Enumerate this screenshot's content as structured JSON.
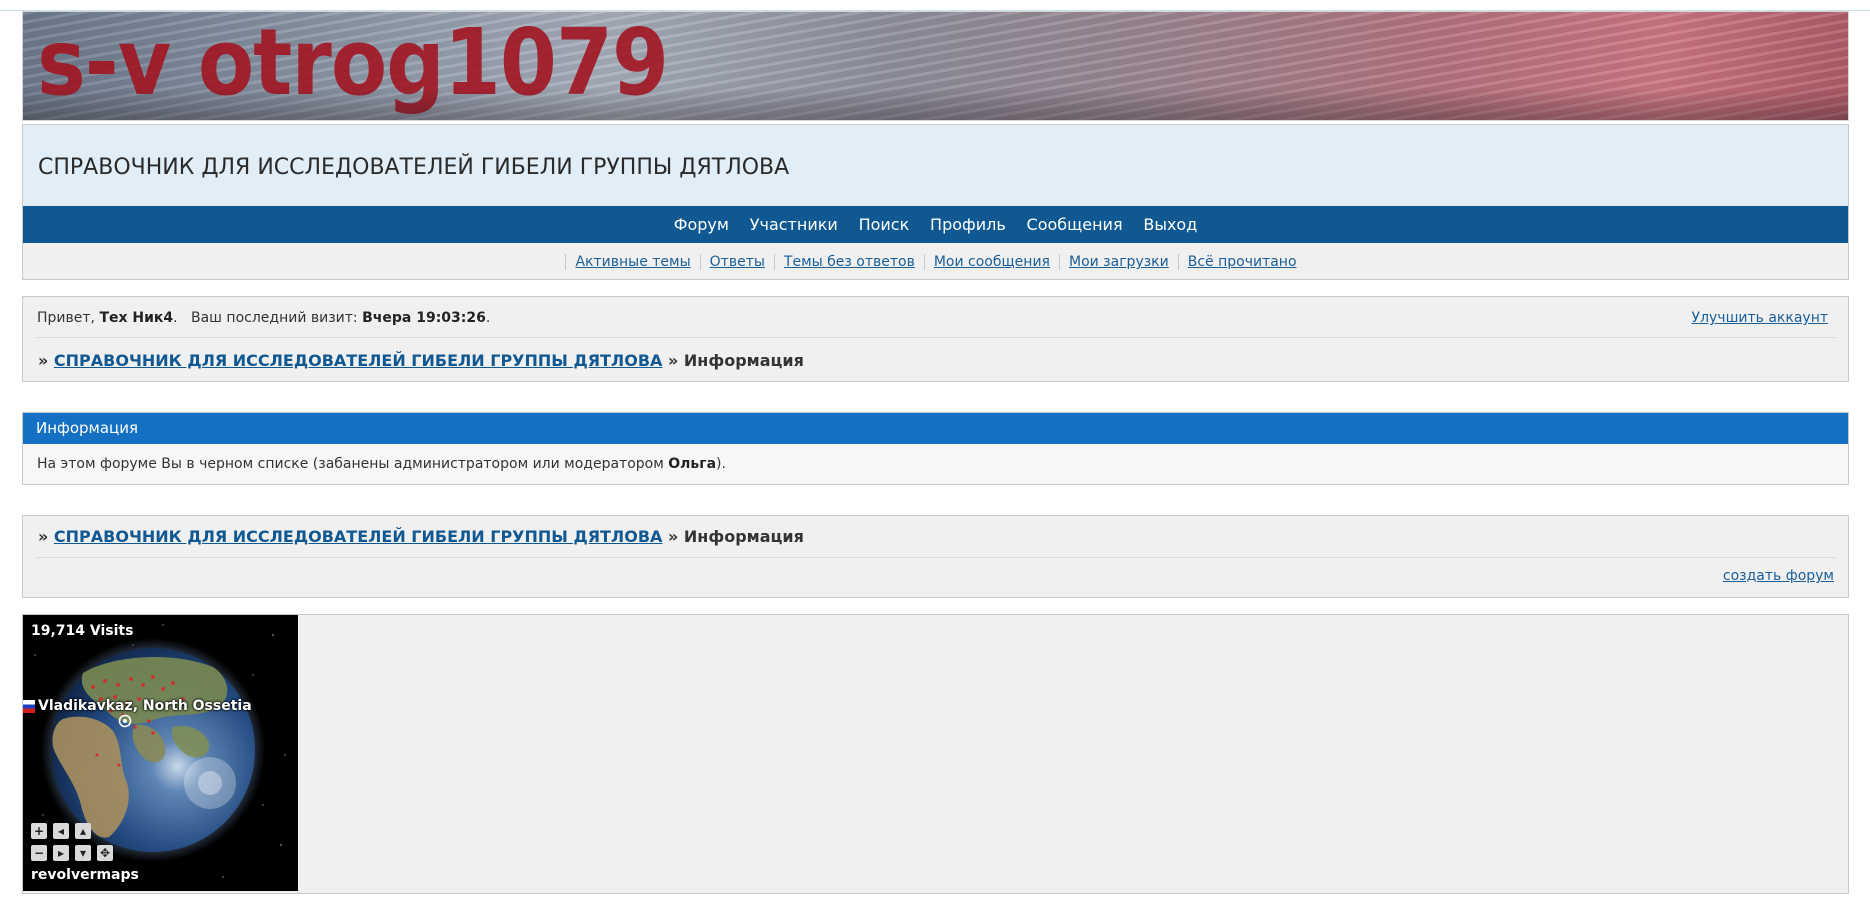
{
  "banner": {
    "title": "s-v otrog1079"
  },
  "site": {
    "title": "СПРАВОЧНИК ДЛЯ ИССЛЕДОВАТЕЛЕЙ ГИБЕЛИ ГРУППЫ ДЯТЛОВА"
  },
  "nav": {
    "main": [
      "Форум",
      "Участники",
      "Поиск",
      "Профиль",
      "Сообщения",
      "Выход"
    ],
    "sub": [
      "Активные темы",
      "Ответы",
      "Темы без ответов",
      "Мои сообщения",
      "Мои загрузки",
      "Всё прочитано"
    ]
  },
  "welcome": {
    "greeting": "Привет,",
    "username": "Тех Ник4",
    "last_visit_label": "Ваш последний визит:",
    "last_visit_value": "Вчера 19:03:26",
    "upgrade": "Улучшить аккаунт"
  },
  "breadcrumb": {
    "sep": "»",
    "forum": "СПРАВОЧНИК ДЛЯ ИССЛЕДОВАТЕЛЕЙ ГИБЕЛИ ГРУППЫ ДЯТЛОВА",
    "current": "Информация"
  },
  "info": {
    "header": "Информация",
    "message_before": "На этом форуме Вы в черном списке (забанены администратором или модератором",
    "moderator": "Ольга",
    "message_after": ")."
  },
  "footer": {
    "create_forum": "создать форум"
  },
  "map": {
    "visits": "19,714 Visits",
    "location": "Vladikavkaz, North Ossetia",
    "brand": "revolvermaps"
  },
  "colors": {
    "nav_bar": "#0f5891",
    "info_header": "#1470c2",
    "link": "#1a5f98",
    "banner_title": "#a3121f"
  }
}
